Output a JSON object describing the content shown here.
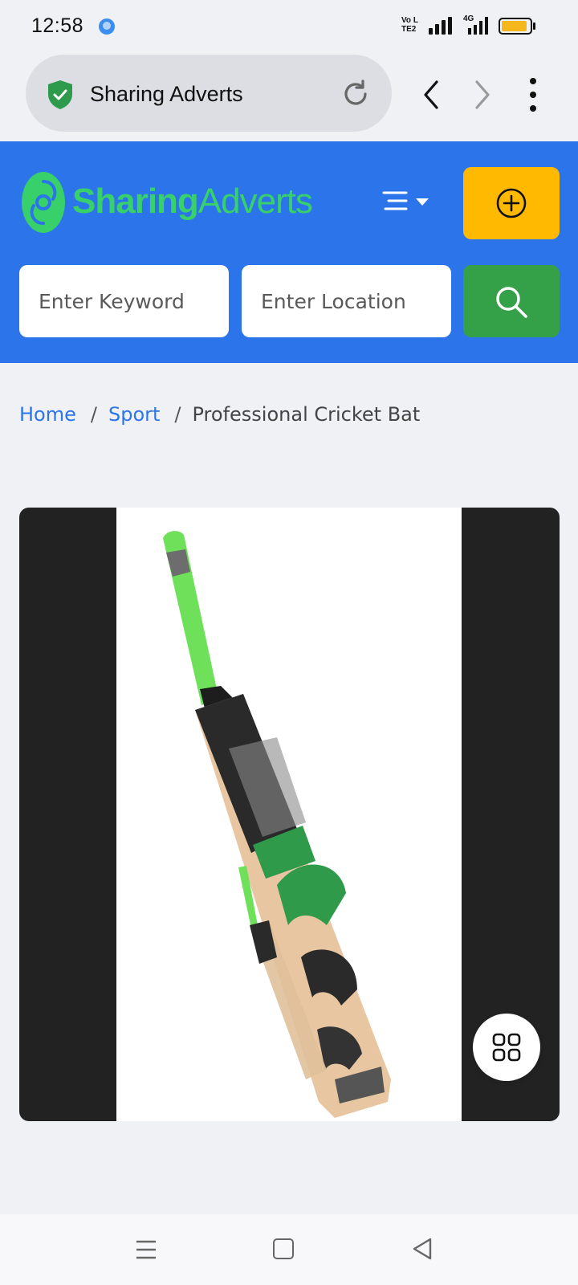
{
  "status_bar": {
    "time": "12:58",
    "volte_label": "Vo LTE2",
    "network_label": "4G"
  },
  "browser": {
    "title": "Sharing Adverts"
  },
  "site": {
    "logo_part1": "Sharing",
    "logo_part2": "Adverts",
    "search": {
      "keyword_placeholder": "Enter Keyword",
      "location_placeholder": "Enter Location"
    }
  },
  "breadcrumb": {
    "items": [
      "Home",
      "Sport",
      "Professional Cricket Bat"
    ],
    "separator": "/"
  },
  "colors": {
    "header_bg": "#2b74ea",
    "post_ad_button": "#ffb900",
    "search_button": "#34a148",
    "logo_green": "#38d06b",
    "link": "#2b74ea"
  },
  "icons": {
    "status": [
      "app-notification-icon",
      "signal-icon",
      "battery-icon"
    ],
    "browser": [
      "shield-check-icon",
      "reload-icon",
      "back-arrow-icon",
      "forward-arrow-icon",
      "more-vert-icon"
    ],
    "header": [
      "logo-icon",
      "hamburger-icon",
      "caret-down-icon",
      "plus-circle-icon",
      "search-icon"
    ],
    "viewer": [
      "grid-icon"
    ],
    "system_nav": [
      "menu-lines-icon",
      "home-square-icon",
      "back-triangle-icon"
    ]
  }
}
